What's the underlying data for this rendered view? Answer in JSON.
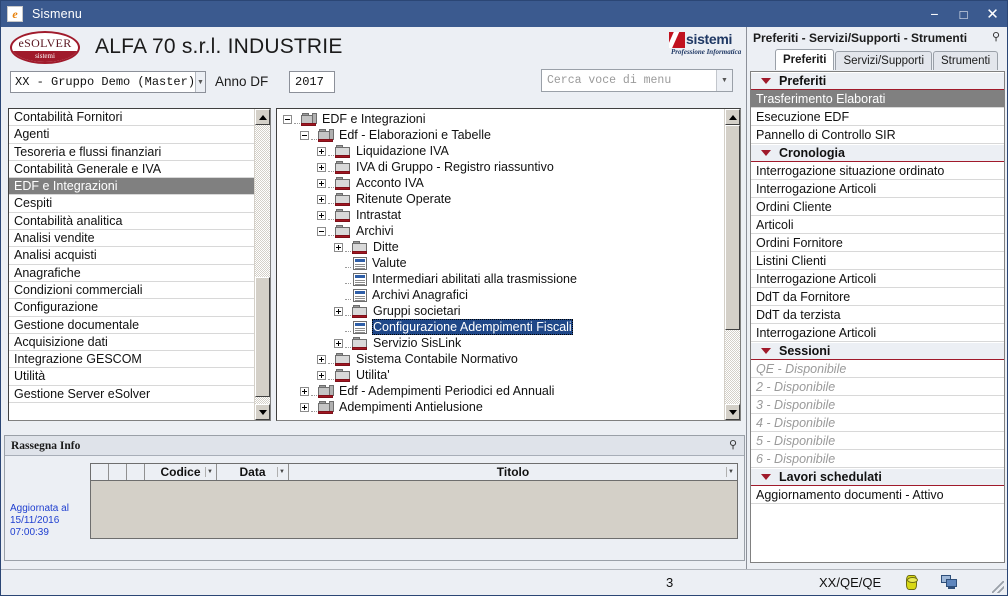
{
  "window": {
    "title": "Sismenu",
    "app_icon": "esolver-e-icon",
    "minimize": "−",
    "maximize": "□",
    "close": "✕"
  },
  "header": {
    "brand_logo_text": "eSOLVER",
    "brand_logo_sub": "sistemi",
    "company": "ALFA 70 s.r.l. INDUSTRIE",
    "vendor_name": "sistemi",
    "vendor_tagline": "Professione Informatica"
  },
  "toolbar": {
    "group_value": "XX - Gruppo Demo (Master)",
    "anno_label": "Anno DF",
    "anno_value": "2017",
    "search_placeholder": "Cerca voce di menu",
    "dropdown_arrow": "▼"
  },
  "categories": {
    "selected": "EDF e Integrazioni",
    "items": [
      "Contabilità Fornitori",
      "Agenti",
      "Tesoreria e flussi finanziari",
      "Contabilità Generale e IVA",
      "EDF e Integrazioni",
      "Cespiti",
      "Contabilità analitica",
      "Analisi vendite",
      "Analisi acquisti",
      "Anagrafiche",
      "Condizioni commerciali",
      "Configurazione",
      "Gestione documentale",
      "Acquisizione dati",
      "Integrazione GESCOM",
      "Utilità",
      "Gestione Server eSolver"
    ]
  },
  "tree": {
    "selected": "Configurazione Adempimenti Fiscali",
    "nodes": [
      {
        "label": "EDF e Integrazioni",
        "depth": 0,
        "icon": "folder-root",
        "expander": "minus"
      },
      {
        "label": "Edf - Elaborazioni e Tabelle",
        "depth": 1,
        "icon": "folder-root",
        "expander": "minus"
      },
      {
        "label": "Liquidazione IVA",
        "depth": 2,
        "icon": "folder",
        "expander": "plus"
      },
      {
        "label": "IVA di Gruppo - Registro riassuntivo",
        "depth": 2,
        "icon": "folder",
        "expander": "plus"
      },
      {
        "label": "Acconto IVA",
        "depth": 2,
        "icon": "folder",
        "expander": "plus"
      },
      {
        "label": "Ritenute Operate",
        "depth": 2,
        "icon": "folder",
        "expander": "plus"
      },
      {
        "label": "Intrastat",
        "depth": 2,
        "icon": "folder",
        "expander": "plus"
      },
      {
        "label": "Archivi",
        "depth": 2,
        "icon": "folder",
        "expander": "minus"
      },
      {
        "label": "Ditte",
        "depth": 3,
        "icon": "folder",
        "expander": "plus"
      },
      {
        "label": "Valute",
        "depth": 3,
        "icon": "document",
        "expander": "none"
      },
      {
        "label": "Intermediari abilitati alla trasmissione",
        "depth": 3,
        "icon": "document",
        "expander": "none"
      },
      {
        "label": "Archivi Anagrafici",
        "depth": 3,
        "icon": "document",
        "expander": "none"
      },
      {
        "label": "Gruppi societari",
        "depth": 3,
        "icon": "folder",
        "expander": "plus"
      },
      {
        "label": "Configurazione Adempimenti Fiscali",
        "depth": 3,
        "icon": "document",
        "expander": "none"
      },
      {
        "label": "Servizio SisLink",
        "depth": 3,
        "icon": "folder",
        "expander": "plus"
      },
      {
        "label": "Sistema Contabile Normativo",
        "depth": 2,
        "icon": "folder",
        "expander": "plus"
      },
      {
        "label": "Utilita'",
        "depth": 2,
        "icon": "folder",
        "expander": "plus"
      },
      {
        "label": "Edf - Adempimenti Periodici ed Annuali",
        "depth": 1,
        "icon": "folder-root",
        "expander": "plus"
      },
      {
        "label": "Adempimenti Antielusione",
        "depth": 1,
        "icon": "folder-root",
        "expander": "plus"
      }
    ]
  },
  "rassegna": {
    "title": "Rassegna Info",
    "pin_icon": "pin-icon",
    "updated_lines": [
      "Aggiornata al",
      "15/11/2016",
      "07:00:39"
    ],
    "columns": [
      "",
      "",
      "",
      "Codice",
      "Data",
      "Titolo"
    ],
    "rows": []
  },
  "dock": {
    "title": "Preferiti - Servizi/Supporti - Strumenti",
    "pin_icon": "pin-icon",
    "tabs": [
      {
        "label": "Preferiti",
        "active": true
      },
      {
        "label": "Servizi/Supporti",
        "active": false
      },
      {
        "label": "Strumenti",
        "active": false
      }
    ],
    "groups": [
      {
        "title": "Preferiti",
        "items": [
          {
            "label": "Trasferimento Elaborati",
            "selected": true,
            "dim": false
          },
          {
            "label": "Esecuzione EDF",
            "selected": false,
            "dim": false
          },
          {
            "label": "Pannello di Controllo SIR",
            "selected": false,
            "dim": false
          }
        ]
      },
      {
        "title": "Cronologia",
        "items": [
          {
            "label": "Interrogazione situazione ordinato",
            "selected": false,
            "dim": false
          },
          {
            "label": "Interrogazione Articoli",
            "selected": false,
            "dim": false
          },
          {
            "label": "Ordini Cliente",
            "selected": false,
            "dim": false
          },
          {
            "label": "Articoli",
            "selected": false,
            "dim": false
          },
          {
            "label": "Ordini Fornitore",
            "selected": false,
            "dim": false
          },
          {
            "label": "Listini Clienti",
            "selected": false,
            "dim": false
          },
          {
            "label": "Interrogazione Articoli",
            "selected": false,
            "dim": false
          },
          {
            "label": "DdT da Fornitore",
            "selected": false,
            "dim": false
          },
          {
            "label": "DdT da terzista",
            "selected": false,
            "dim": false
          },
          {
            "label": "Interrogazione Articoli",
            "selected": false,
            "dim": false
          }
        ]
      },
      {
        "title": "Sessioni",
        "items": [
          {
            "label": "QE - Disponibile",
            "selected": false,
            "dim": true
          },
          {
            "label": "2 - Disponibile",
            "selected": false,
            "dim": true
          },
          {
            "label": "3 - Disponibile",
            "selected": false,
            "dim": true
          },
          {
            "label": "4 - Disponibile",
            "selected": false,
            "dim": true
          },
          {
            "label": "5 - Disponibile",
            "selected": false,
            "dim": true
          },
          {
            "label": "6 - Disponibile",
            "selected": false,
            "dim": true
          }
        ]
      },
      {
        "title": "Lavori schedulati",
        "items": [
          {
            "label": "Aggiornamento documenti - Attivo",
            "selected": false,
            "dim": false
          }
        ]
      }
    ]
  },
  "statusbar": {
    "count": "3",
    "user": "XX/QE/QE",
    "db_icon": "database-icon",
    "net_icon": "network-icon"
  },
  "colors": {
    "titlebar": "#3b5a8f",
    "accent_red": "#a01a2b",
    "selection_gray": "#808080",
    "selection_blue": "#1f4788",
    "link_blue": "#1f3fd0"
  }
}
